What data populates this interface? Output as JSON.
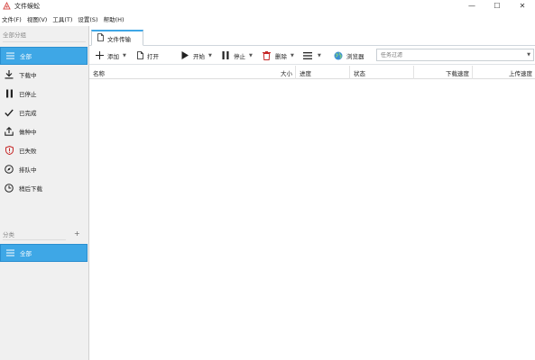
{
  "window": {
    "title": "文件蜈蚣",
    "controls": {
      "minimize": "—",
      "maximize": "☐",
      "close": "✕"
    }
  },
  "menu": [
    {
      "label": "文件(F)"
    },
    {
      "label": "视图(V)"
    },
    {
      "label": "工具(T)"
    },
    {
      "label": "设置(S)"
    },
    {
      "label": "帮助(H)"
    }
  ],
  "sidebar": {
    "group_label": "全部分组",
    "items": [
      {
        "label": "全部",
        "icon": "list-icon"
      },
      {
        "label": "下载中",
        "icon": "download-icon"
      },
      {
        "label": "已停止",
        "icon": "pause-icon"
      },
      {
        "label": "已完成",
        "icon": "check-icon"
      },
      {
        "label": "做种中",
        "icon": "upload-icon"
      },
      {
        "label": "已失败",
        "icon": "error-shield-icon"
      },
      {
        "label": "排队中",
        "icon": "compass-icon"
      },
      {
        "label": "稍后下载",
        "icon": "clock-icon"
      }
    ],
    "category_label": "分类",
    "category_add": "+",
    "categories": [
      {
        "label": "全部",
        "icon": "list-icon"
      }
    ]
  },
  "tabs": [
    {
      "label": "文件传输",
      "icon": "file-icon"
    }
  ],
  "toolbar": {
    "add": "添加",
    "open": "打开",
    "start": "开始",
    "stop": "停止",
    "delete": "删除",
    "browser": "浏览器",
    "filter_placeholder": "任务过滤"
  },
  "table": {
    "columns": [
      "名称",
      "大小",
      "进度",
      "状态",
      "下载速度",
      "上传速度"
    ]
  }
}
